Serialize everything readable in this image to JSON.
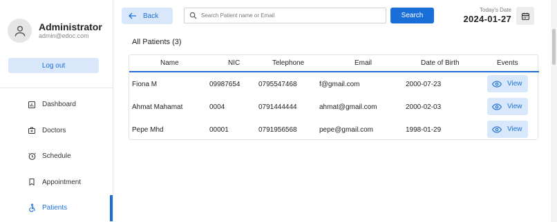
{
  "profile": {
    "name": "Administrator",
    "email": "admin@edoc.com"
  },
  "logout_label": "Log out",
  "nav": [
    {
      "label": "Dashboard",
      "icon": "dashboard-icon"
    },
    {
      "label": "Doctors",
      "icon": "doctors-icon"
    },
    {
      "label": "Schedule",
      "icon": "clock-icon"
    },
    {
      "label": "Appointment",
      "icon": "bookmark-icon"
    },
    {
      "label": "Patients",
      "icon": "accessibility-icon",
      "active": true
    }
  ],
  "header": {
    "back_label": "Back",
    "search_placeholder": "Search Patient name or Email",
    "search_button": "Search",
    "date_label": "Today's Date",
    "date_value": "2024-01-27"
  },
  "list_title": "All Patients (3)",
  "table": {
    "columns": [
      "Name",
      "NIC",
      "Telephone",
      "Email",
      "Date of Birth",
      "Events"
    ],
    "rows": [
      {
        "name": "Fiona M",
        "nic": "09987654",
        "telephone": "0795547468",
        "email": "f@gmail.com",
        "dob": "2000-07-23",
        "action": "View"
      },
      {
        "name": "Ahmat Mahamat",
        "nic": "0004",
        "telephone": "0791444444",
        "email": "ahmat@gmail.com",
        "dob": "2000-02-03",
        "action": "View"
      },
      {
        "name": "Pepe Mhd",
        "nic": "00001",
        "telephone": "0791956568",
        "email": "pepe@gmail.com",
        "dob": "1998-01-29",
        "action": "View"
      }
    ]
  },
  "colors": {
    "accent": "#1a6ed8",
    "accent_light": "#d8e8fa"
  }
}
